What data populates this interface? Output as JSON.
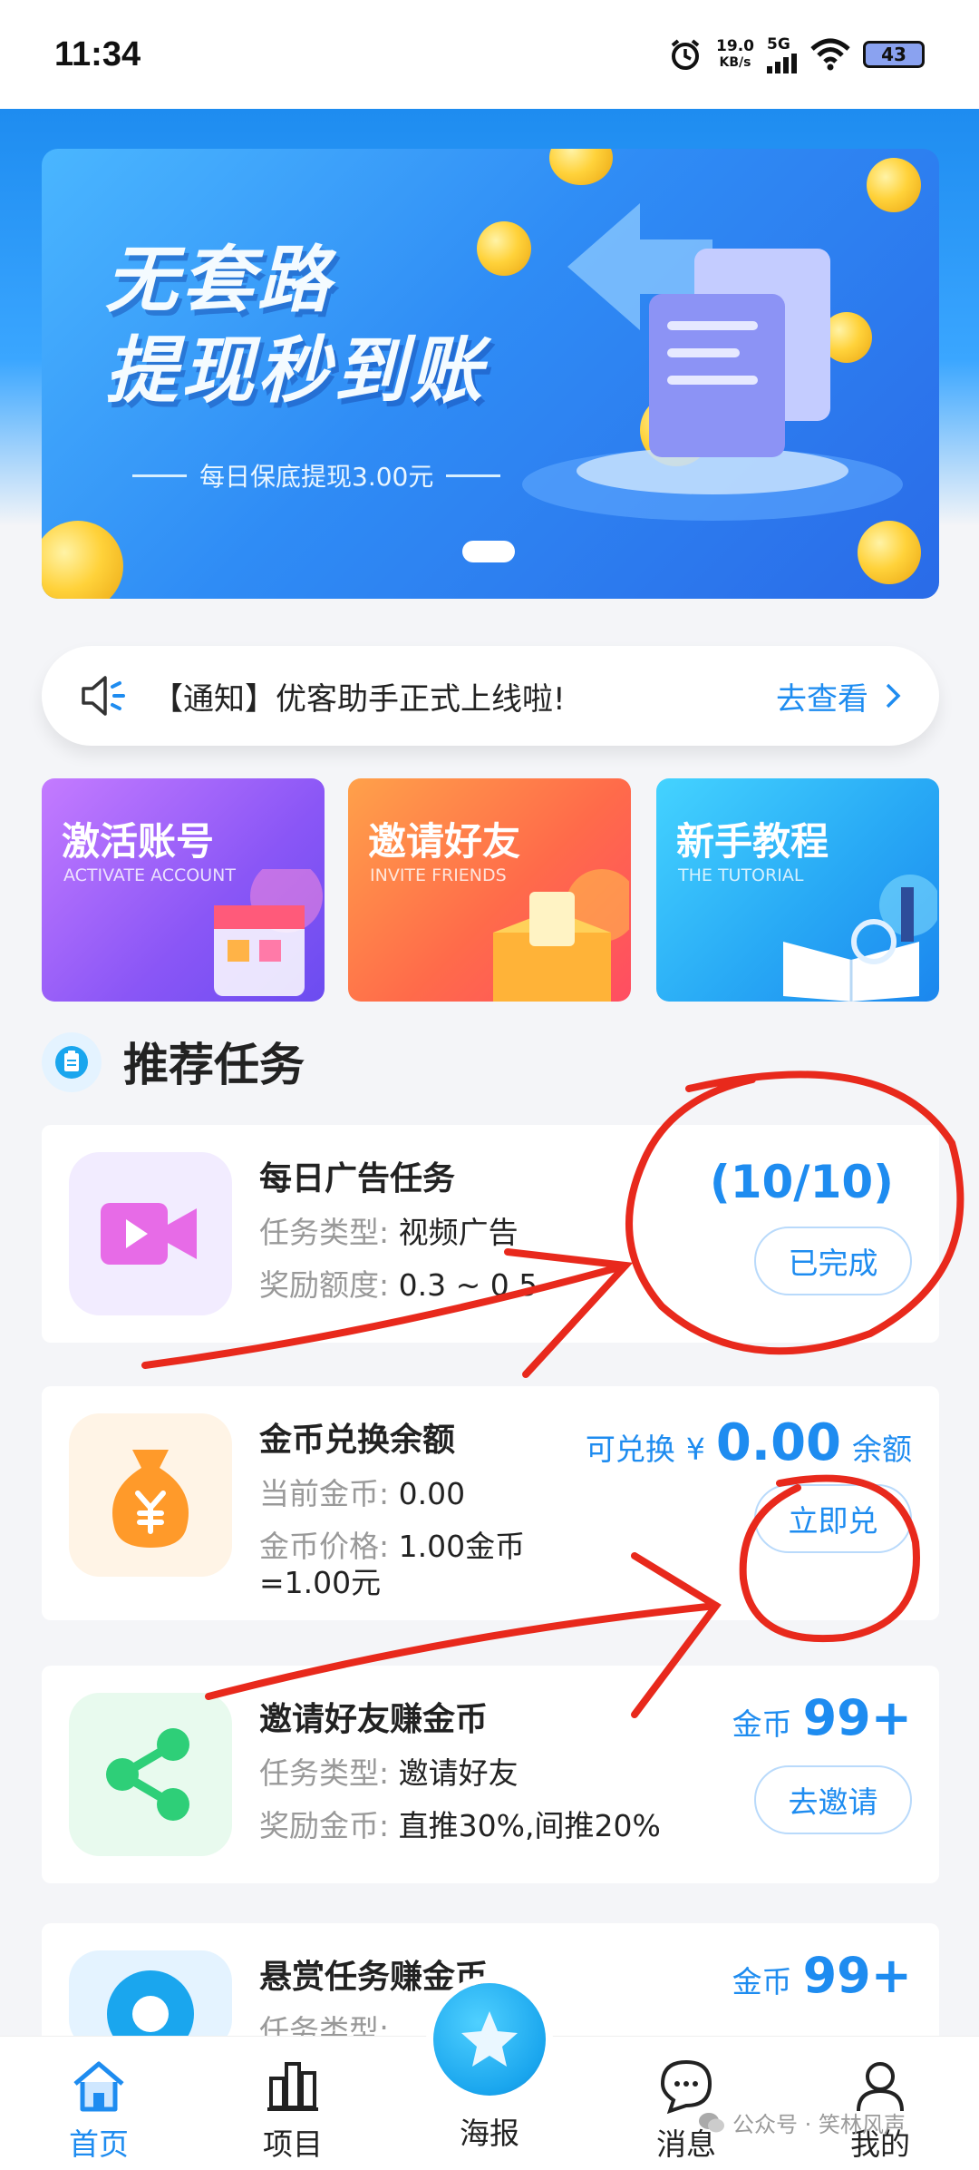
{
  "status": {
    "time": "11:34",
    "speed_value": "19.0",
    "speed_unit": "KB/s",
    "network": "5G",
    "battery": "43"
  },
  "banner": {
    "title_line1": "无套路",
    "title_line2": "提现秒到账",
    "subtitle": "每日保底提现3.00元"
  },
  "notice": {
    "text": "【通知】优客助手正式上线啦!",
    "link": "去查看"
  },
  "quick": [
    {
      "title": "激活账号",
      "sub": "ACTIVATE ACCOUNT",
      "color1": "#b56bff",
      "color2": "#7a56f5"
    },
    {
      "title": "邀请好友",
      "sub": "INVITE FRIENDS",
      "color1": "#ff8a4a",
      "color2": "#ff4f5a"
    },
    {
      "title": "新手教程",
      "sub": "THE TUTORIAL",
      "color1": "#31c4ff",
      "color2": "#1a8cf0"
    }
  ],
  "section": {
    "title": "推荐任务"
  },
  "tasks": [
    {
      "title": "每日广告任务",
      "line1_label": "任务类型:",
      "line1_value": "视频广告",
      "line2_label": "奖励额度:",
      "line2_value": "0.3 ~ 0.5",
      "progress": "(10/10)",
      "button": "已完成"
    },
    {
      "title": "金币兑换余额",
      "line1_label": "当前金币:",
      "line1_value": "0.00",
      "line2_label": "金币价格:",
      "line2_value": "1.00金币",
      "line3": "=1.00元",
      "exchange_label": "可兑换",
      "currency": "¥",
      "exchange_amount": "0.00",
      "exchange_unit": "余额",
      "button": "立即兑"
    },
    {
      "title": "邀请好友赚金币",
      "line1_label": "任务类型:",
      "line1_value": "邀请好友",
      "line2_label": "奖励金币:",
      "line2_value": "直推30%,间推20%",
      "coin_label": "金币",
      "coin_value": "99+",
      "button": "去邀请"
    },
    {
      "title": "悬赏任务赚金币",
      "line1_label": "任务类型:",
      "coin_label": "金币",
      "coin_value": "99+"
    }
  ],
  "nav": [
    {
      "label": "首页",
      "icon": "home-icon",
      "active": true
    },
    {
      "label": "项目",
      "icon": "project-icon"
    },
    {
      "label": "海报",
      "icon": "poster-star-icon"
    },
    {
      "label": "消息",
      "icon": "message-icon"
    },
    {
      "label": "我的",
      "icon": "profile-icon"
    }
  ],
  "watermark": "公众号 · 笑林风声",
  "colors": {
    "accent": "#1e8cf0",
    "annotation": "#e8291c"
  }
}
